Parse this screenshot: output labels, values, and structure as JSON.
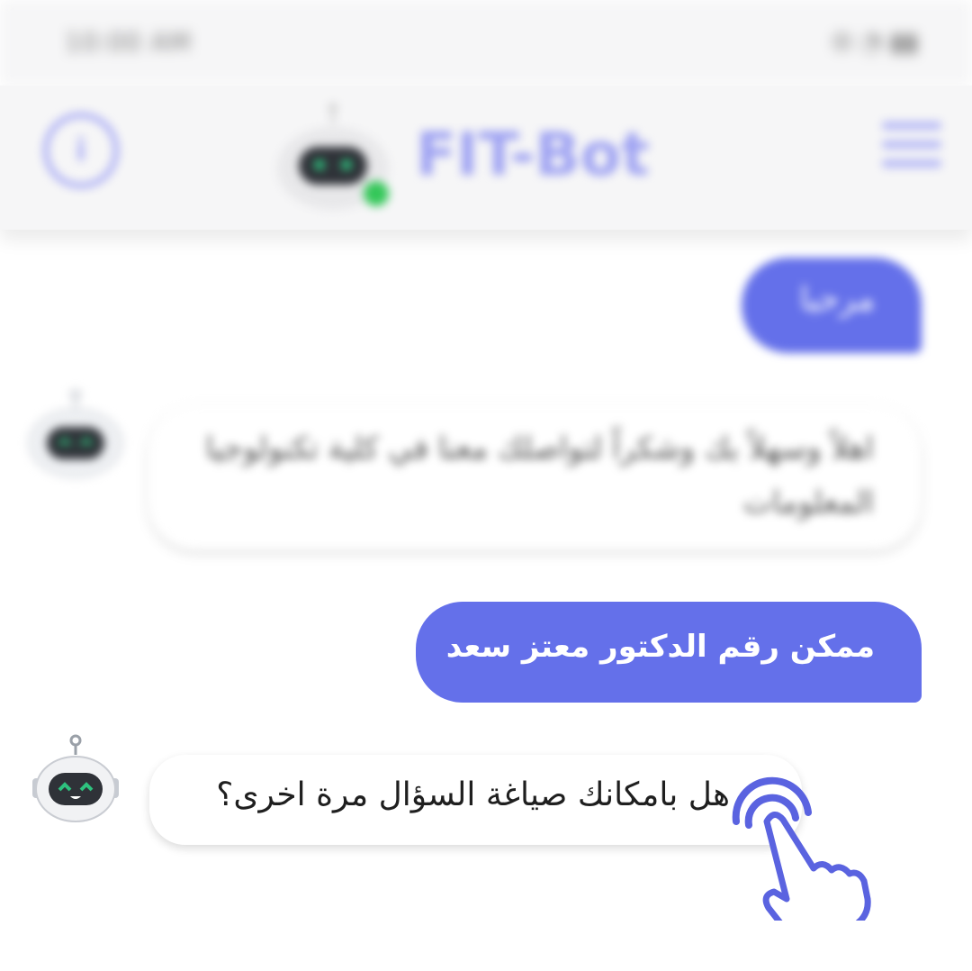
{
  "status_bar": {
    "time": "10:00 AM",
    "icons": "⦾ ◔ ▮▮"
  },
  "header": {
    "title": "FIT-Bot",
    "info_icon": "info-icon",
    "menu_icon": "hamburger-menu-icon",
    "online_color": "#34c759"
  },
  "accent_color": "#6470ea",
  "messages": [
    {
      "sender": "user",
      "text": "مرحبا"
    },
    {
      "sender": "bot",
      "text": "اهلاً وسهلاً بك وشكراً لتواصلك معنا في كلية تكنولوجيا المعلومات"
    },
    {
      "sender": "user",
      "text": "ممكن رقم الدكتور معتز سعد"
    },
    {
      "sender": "bot",
      "text": "هل بامكانك صياغة السؤال مرة اخرى؟"
    }
  ],
  "overlay": {
    "icon": "tap-hand-icon"
  }
}
